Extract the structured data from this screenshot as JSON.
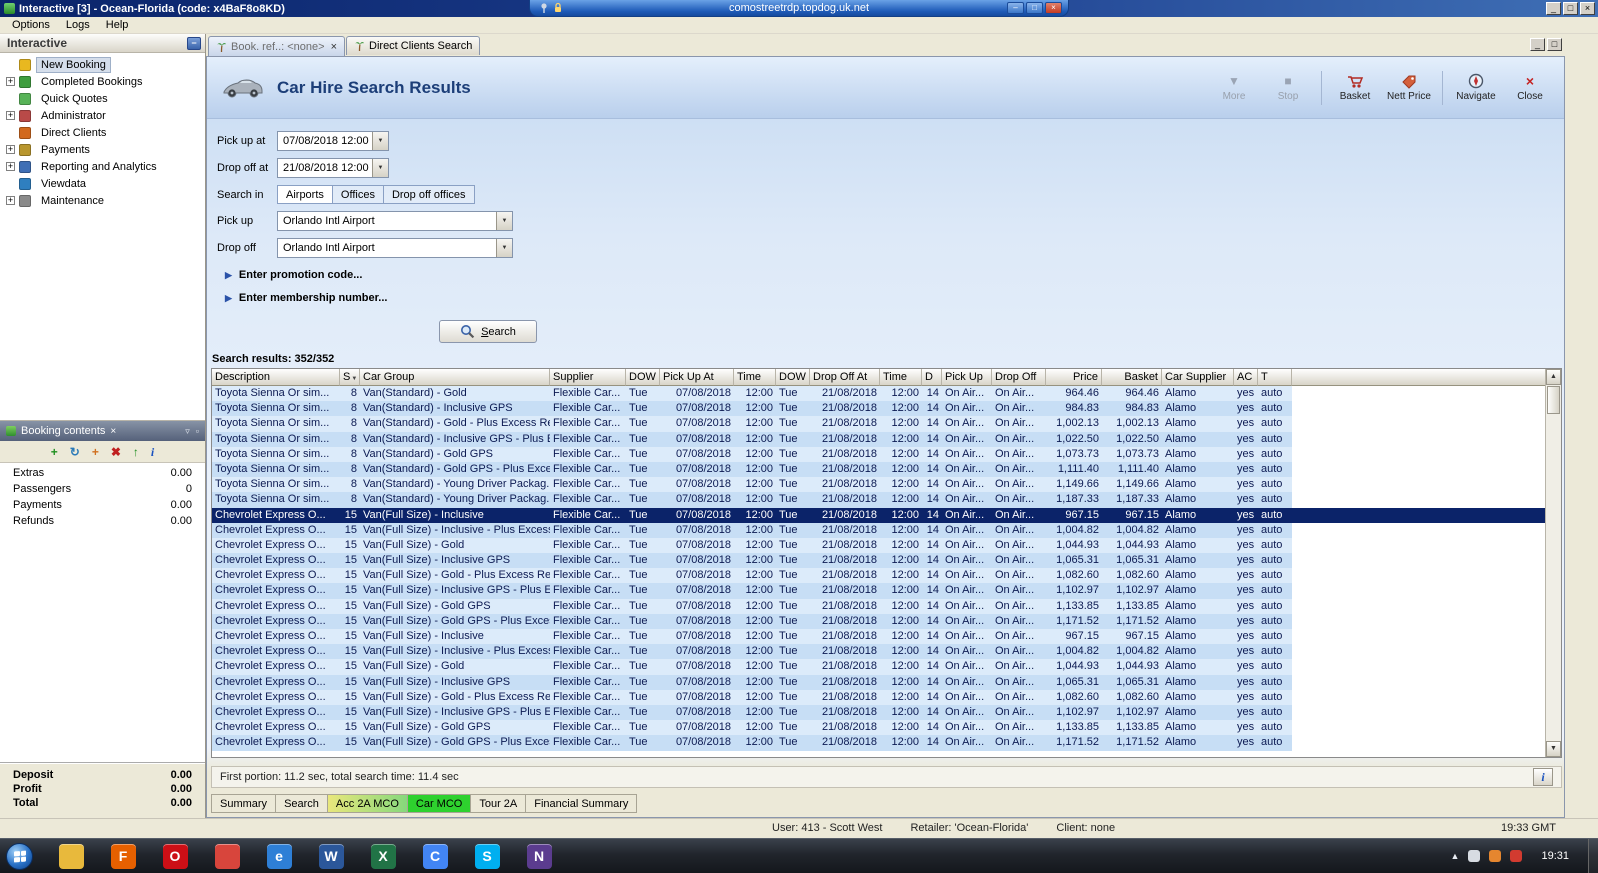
{
  "window": {
    "title": "Interactive [3] - Ocean-Florida (code: x4BaF8o8KD)",
    "rdp_host": "comostreetrdp.topdog.uk.net"
  },
  "menubar": [
    "Options",
    "Logs",
    "Help"
  ],
  "sidebar": {
    "title": "Interactive",
    "items": [
      {
        "label": "New Booking",
        "icon": "new-booking-icon",
        "color": "#e8b820",
        "expandable": false,
        "selected": true
      },
      {
        "label": "Completed Bookings",
        "icon": "completed-bookings-icon",
        "color": "#3f9e3f",
        "expandable": true,
        "selected": false
      },
      {
        "label": "Quick Quotes",
        "icon": "quick-quotes-icon",
        "color": "#58b358",
        "expandable": false,
        "selected": false
      },
      {
        "label": "Administrator",
        "icon": "administrator-icon",
        "color": "#b94a48",
        "expandable": true,
        "selected": false
      },
      {
        "label": "Direct Clients",
        "icon": "direct-clients-icon",
        "color": "#d2691e",
        "expandable": false,
        "selected": false
      },
      {
        "label": "Payments",
        "icon": "payments-icon",
        "color": "#b8962e",
        "expandable": true,
        "selected": false
      },
      {
        "label": "Reporting and Analytics",
        "icon": "reporting-analytics-icon",
        "color": "#3f6fb5",
        "expandable": true,
        "selected": false
      },
      {
        "label": "Viewdata",
        "icon": "viewdata-icon",
        "color": "#2f7fbf",
        "expandable": false,
        "selected": false
      },
      {
        "label": "Maintenance",
        "icon": "maintenance-icon",
        "color": "#8a8a8a",
        "expandable": true,
        "selected": false
      }
    ]
  },
  "booking_contents": {
    "title": "Booking contents",
    "rows": [
      {
        "label": "Extras",
        "value": "0.00"
      },
      {
        "label": "Passengers",
        "value": "0"
      },
      {
        "label": "Payments",
        "value": "0.00"
      },
      {
        "label": "Refunds",
        "value": "0.00"
      }
    ],
    "totals": [
      {
        "label": "Deposit",
        "value": "0.00"
      },
      {
        "label": "Profit",
        "value": "0.00"
      },
      {
        "label": "Total",
        "value": "0.00"
      }
    ]
  },
  "tabs": [
    {
      "label": "Book. ref..: <none>",
      "active": true
    },
    {
      "label": "Direct Clients Search",
      "active": false
    }
  ],
  "page": {
    "title": "Car Hire Search Results",
    "toolbar": {
      "more": "More",
      "stop": "Stop",
      "basket": "Basket",
      "nett_price": "Nett Price",
      "navigate": "Navigate",
      "close": "Close"
    },
    "form": {
      "pick_up_at_label": "Pick up at",
      "pick_up_at_value": "07/08/2018 12:00",
      "drop_off_at_label": "Drop off at",
      "drop_off_at_value": "21/08/2018 12:00",
      "search_in_label": "Search in",
      "search_in_options": [
        {
          "label": "Airports",
          "active": true
        },
        {
          "label": "Offices",
          "active": false
        },
        {
          "label": "Drop off offices",
          "active": false
        }
      ],
      "pick_up_label": "Pick up",
      "pick_up_value": "Orlando Intl Airport",
      "drop_off_label": "Drop off",
      "drop_off_value": "Orlando Intl Airport",
      "promo_label": "Enter promotion code...",
      "membership_label": "Enter membership number...",
      "search_label": "Search"
    },
    "results_count": "Search results: 352/352",
    "columns": [
      "Description",
      "S",
      "Car Group",
      "Supplier",
      "DOW",
      "Pick Up At",
      "Time",
      "DOW",
      "Drop Off At",
      "Time",
      "D",
      "Pick Up",
      "Drop Off",
      "Price",
      "Basket",
      "Car Supplier",
      "AC",
      "T"
    ],
    "rows": [
      {
        "cells": [
          "Toyota Sienna Or sim...",
          "8",
          "Van(Standard) - Gold",
          "Flexible Car...",
          "Tue",
          "07/08/2018",
          "12:00",
          "Tue",
          "21/08/2018",
          "12:00",
          "14",
          "On Air...",
          "On Air...",
          "964.46",
          "964.46",
          "Alamo",
          "yes",
          "auto"
        ]
      },
      {
        "cells": [
          "Toyota Sienna Or sim...",
          "8",
          "Van(Standard) - Inclusive GPS",
          "Flexible Car...",
          "Tue",
          "07/08/2018",
          "12:00",
          "Tue",
          "21/08/2018",
          "12:00",
          "14",
          "On Air...",
          "On Air...",
          "984.83",
          "984.83",
          "Alamo",
          "yes",
          "auto"
        ]
      },
      {
        "cells": [
          "Toyota Sienna Or sim...",
          "8",
          "Van(Standard) - Gold - Plus Excess Re...",
          "Flexible Car...",
          "Tue",
          "07/08/2018",
          "12:00",
          "Tue",
          "21/08/2018",
          "12:00",
          "14",
          "On Air...",
          "On Air...",
          "1,002.13",
          "1,002.13",
          "Alamo",
          "yes",
          "auto"
        ]
      },
      {
        "cells": [
          "Toyota Sienna Or sim...",
          "8",
          "Van(Standard) - Inclusive GPS - Plus E...",
          "Flexible Car...",
          "Tue",
          "07/08/2018",
          "12:00",
          "Tue",
          "21/08/2018",
          "12:00",
          "14",
          "On Air...",
          "On Air...",
          "1,022.50",
          "1,022.50",
          "Alamo",
          "yes",
          "auto"
        ]
      },
      {
        "cells": [
          "Toyota Sienna Or sim...",
          "8",
          "Van(Standard) - Gold GPS",
          "Flexible Car...",
          "Tue",
          "07/08/2018",
          "12:00",
          "Tue",
          "21/08/2018",
          "12:00",
          "14",
          "On Air...",
          "On Air...",
          "1,073.73",
          "1,073.73",
          "Alamo",
          "yes",
          "auto"
        ]
      },
      {
        "cells": [
          "Toyota Sienna Or sim...",
          "8",
          "Van(Standard) - Gold GPS - Plus Exce...",
          "Flexible Car...",
          "Tue",
          "07/08/2018",
          "12:00",
          "Tue",
          "21/08/2018",
          "12:00",
          "14",
          "On Air...",
          "On Air...",
          "1,111.40",
          "1,111.40",
          "Alamo",
          "yes",
          "auto"
        ]
      },
      {
        "cells": [
          "Toyota Sienna Or sim...",
          "8",
          "Van(Standard) - Young Driver Packag...",
          "Flexible Car...",
          "Tue",
          "07/08/2018",
          "12:00",
          "Tue",
          "21/08/2018",
          "12:00",
          "14",
          "On Air...",
          "On Air...",
          "1,149.66",
          "1,149.66",
          "Alamo",
          "yes",
          "auto"
        ]
      },
      {
        "cells": [
          "Toyota Sienna Or sim...",
          "8",
          "Van(Standard) - Young Driver Packag...",
          "Flexible Car...",
          "Tue",
          "07/08/2018",
          "12:00",
          "Tue",
          "21/08/2018",
          "12:00",
          "14",
          "On Air...",
          "On Air...",
          "1,187.33",
          "1,187.33",
          "Alamo",
          "yes",
          "auto"
        ]
      },
      {
        "cells": [
          "Chevrolet Express O...",
          "15",
          "Van(Full Size) - Inclusive",
          "Flexible Car...",
          "Tue",
          "07/08/2018",
          "12:00",
          "Tue",
          "21/08/2018",
          "12:00",
          "14",
          "On Air...",
          "On Air...",
          "967.15",
          "967.15",
          "Alamo",
          "yes",
          "auto"
        ],
        "selected": true
      },
      {
        "cells": [
          "Chevrolet Express O...",
          "15",
          "Van(Full Size) - Inclusive - Plus Excess...",
          "Flexible Car...",
          "Tue",
          "07/08/2018",
          "12:00",
          "Tue",
          "21/08/2018",
          "12:00",
          "14",
          "On Air...",
          "On Air...",
          "1,004.82",
          "1,004.82",
          "Alamo",
          "yes",
          "auto"
        ]
      },
      {
        "cells": [
          "Chevrolet Express O...",
          "15",
          "Van(Full Size) - Gold",
          "Flexible Car...",
          "Tue",
          "07/08/2018",
          "12:00",
          "Tue",
          "21/08/2018",
          "12:00",
          "14",
          "On Air...",
          "On Air...",
          "1,044.93",
          "1,044.93",
          "Alamo",
          "yes",
          "auto"
        ]
      },
      {
        "cells": [
          "Chevrolet Express O...",
          "15",
          "Van(Full Size) - Inclusive GPS",
          "Flexible Car...",
          "Tue",
          "07/08/2018",
          "12:00",
          "Tue",
          "21/08/2018",
          "12:00",
          "14",
          "On Air...",
          "On Air...",
          "1,065.31",
          "1,065.31",
          "Alamo",
          "yes",
          "auto"
        ]
      },
      {
        "cells": [
          "Chevrolet Express O...",
          "15",
          "Van(Full Size) - Gold - Plus Excess Ref...",
          "Flexible Car...",
          "Tue",
          "07/08/2018",
          "12:00",
          "Tue",
          "21/08/2018",
          "12:00",
          "14",
          "On Air...",
          "On Air...",
          "1,082.60",
          "1,082.60",
          "Alamo",
          "yes",
          "auto"
        ]
      },
      {
        "cells": [
          "Chevrolet Express O...",
          "15",
          "Van(Full Size) - Inclusive GPS - Plus Ex...",
          "Flexible Car...",
          "Tue",
          "07/08/2018",
          "12:00",
          "Tue",
          "21/08/2018",
          "12:00",
          "14",
          "On Air...",
          "On Air...",
          "1,102.97",
          "1,102.97",
          "Alamo",
          "yes",
          "auto"
        ]
      },
      {
        "cells": [
          "Chevrolet Express O...",
          "15",
          "Van(Full Size) - Gold GPS",
          "Flexible Car...",
          "Tue",
          "07/08/2018",
          "12:00",
          "Tue",
          "21/08/2018",
          "12:00",
          "14",
          "On Air...",
          "On Air...",
          "1,133.85",
          "1,133.85",
          "Alamo",
          "yes",
          "auto"
        ]
      },
      {
        "cells": [
          "Chevrolet Express O...",
          "15",
          "Van(Full Size) - Gold GPS - Plus Excess...",
          "Flexible Car...",
          "Tue",
          "07/08/2018",
          "12:00",
          "Tue",
          "21/08/2018",
          "12:00",
          "14",
          "On Air...",
          "On Air...",
          "1,171.52",
          "1,171.52",
          "Alamo",
          "yes",
          "auto"
        ]
      },
      {
        "cells": [
          "Chevrolet Express O...",
          "15",
          "Van(Full Size) - Inclusive",
          "Flexible Car...",
          "Tue",
          "07/08/2018",
          "12:00",
          "Tue",
          "21/08/2018",
          "12:00",
          "14",
          "On Air...",
          "On Air...",
          "967.15",
          "967.15",
          "Alamo",
          "yes",
          "auto"
        ]
      },
      {
        "cells": [
          "Chevrolet Express O...",
          "15",
          "Van(Full Size) - Inclusive - Plus Excess...",
          "Flexible Car...",
          "Tue",
          "07/08/2018",
          "12:00",
          "Tue",
          "21/08/2018",
          "12:00",
          "14",
          "On Air...",
          "On Air...",
          "1,004.82",
          "1,004.82",
          "Alamo",
          "yes",
          "auto"
        ]
      },
      {
        "cells": [
          "Chevrolet Express O...",
          "15",
          "Van(Full Size) - Gold",
          "Flexible Car...",
          "Tue",
          "07/08/2018",
          "12:00",
          "Tue",
          "21/08/2018",
          "12:00",
          "14",
          "On Air...",
          "On Air...",
          "1,044.93",
          "1,044.93",
          "Alamo",
          "yes",
          "auto"
        ]
      },
      {
        "cells": [
          "Chevrolet Express O...",
          "15",
          "Van(Full Size) - Inclusive GPS",
          "Flexible Car...",
          "Tue",
          "07/08/2018",
          "12:00",
          "Tue",
          "21/08/2018",
          "12:00",
          "14",
          "On Air...",
          "On Air...",
          "1,065.31",
          "1,065.31",
          "Alamo",
          "yes",
          "auto"
        ]
      },
      {
        "cells": [
          "Chevrolet Express O...",
          "15",
          "Van(Full Size) - Gold - Plus Excess Ref...",
          "Flexible Car...",
          "Tue",
          "07/08/2018",
          "12:00",
          "Tue",
          "21/08/2018",
          "12:00",
          "14",
          "On Air...",
          "On Air...",
          "1,082.60",
          "1,082.60",
          "Alamo",
          "yes",
          "auto"
        ]
      },
      {
        "cells": [
          "Chevrolet Express O...",
          "15",
          "Van(Full Size) - Inclusive GPS - Plus Ex...",
          "Flexible Car...",
          "Tue",
          "07/08/2018",
          "12:00",
          "Tue",
          "21/08/2018",
          "12:00",
          "14",
          "On Air...",
          "On Air...",
          "1,102.97",
          "1,102.97",
          "Alamo",
          "yes",
          "auto"
        ]
      },
      {
        "cells": [
          "Chevrolet Express O...",
          "15",
          "Van(Full Size) - Gold GPS",
          "Flexible Car...",
          "Tue",
          "07/08/2018",
          "12:00",
          "Tue",
          "21/08/2018",
          "12:00",
          "14",
          "On Air...",
          "On Air...",
          "1,133.85",
          "1,133.85",
          "Alamo",
          "yes",
          "auto"
        ]
      },
      {
        "cells": [
          "Chevrolet Express O...",
          "15",
          "Van(Full Size) - Gold GPS - Plus Excess...",
          "Flexible Car...",
          "Tue",
          "07/08/2018",
          "12:00",
          "Tue",
          "21/08/2018",
          "12:00",
          "14",
          "On Air...",
          "On Air...",
          "1,171.52",
          "1,171.52",
          "Alamo",
          "yes",
          "auto"
        ]
      }
    ],
    "status": "First portion: 11.2 sec, total search time: 11.4 sec",
    "bottom_tabs": [
      {
        "label": "Summary",
        "style": "plain"
      },
      {
        "label": "Search",
        "style": "plain"
      },
      {
        "label": "Acc 2A MCO",
        "style": "acc"
      },
      {
        "label": "Car MCO",
        "style": "car"
      },
      {
        "label": "Tour 2A",
        "style": "plain"
      },
      {
        "label": "Financial Summary",
        "style": "plain"
      }
    ]
  },
  "statusbar": {
    "user": "User: 413 - Scott West",
    "retailer": "Retailer: 'Ocean-Florida'",
    "client": "Client: none",
    "time": "19:33 GMT"
  },
  "taskbar": {
    "clock": "19:31",
    "icons": [
      {
        "name": "explorer-folder-icon",
        "letter": "",
        "color": "#e8b93c"
      },
      {
        "name": "firefox-icon",
        "letter": "F",
        "color": "#e66000"
      },
      {
        "name": "opera-icon",
        "letter": "O",
        "color": "#cc0f16"
      },
      {
        "name": "media-player-icon",
        "letter": "",
        "color": "#d8453c"
      },
      {
        "name": "ie-icon",
        "letter": "e",
        "color": "#2e7fd6"
      },
      {
        "name": "word-icon",
        "letter": "W",
        "color": "#2b579a"
      },
      {
        "name": "excel-icon",
        "letter": "X",
        "color": "#217346"
      },
      {
        "name": "chrome-icon",
        "letter": "C",
        "color": "#4285f4"
      },
      {
        "name": "skype-icon",
        "letter": "S",
        "color": "#00aff0"
      },
      {
        "name": "notepadpp-icon",
        "letter": "N",
        "color": "#5b3c8f"
      }
    ]
  }
}
